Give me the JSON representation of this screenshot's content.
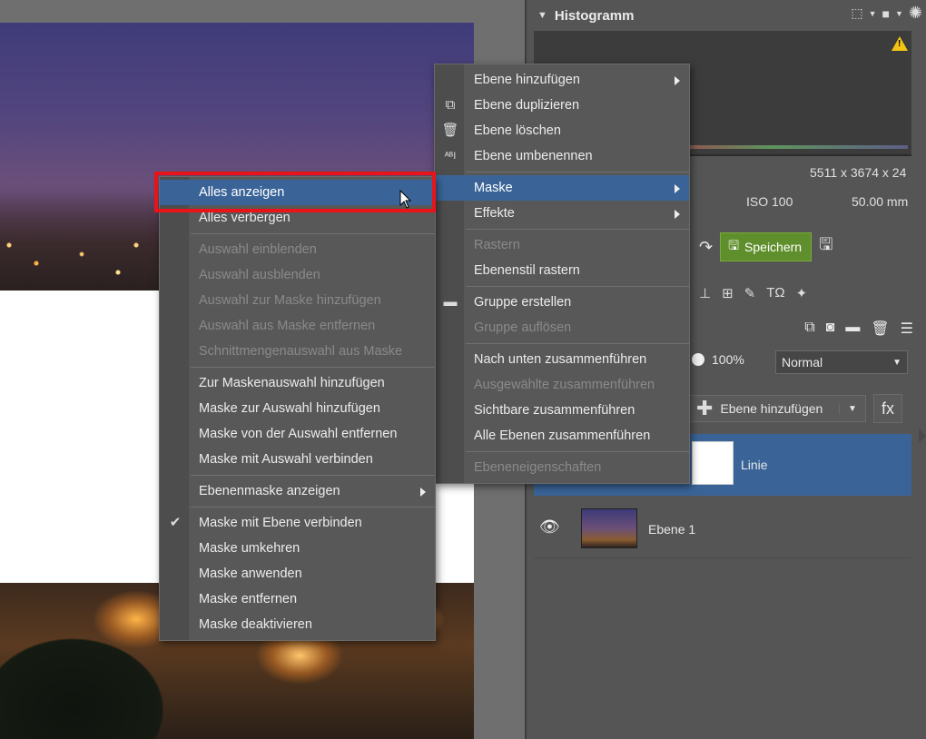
{
  "histogram": {
    "title": "Histogramm",
    "dimensions": "5511 x 3674 x 24",
    "iso": "ISO 100",
    "focal": "50.00 mm"
  },
  "toolbar": {
    "save_label": "Speichern"
  },
  "layers": {
    "opacity": "100%",
    "blend_mode": "Normal",
    "add_layer_label": "Ebene hinzufügen",
    "fx_label": "fx",
    "items": [
      {
        "name": "Linie",
        "selected": true
      },
      {
        "name": "Ebene 1",
        "selected": false
      }
    ]
  },
  "main_menu": {
    "items": [
      {
        "label": "Ebene hinzufügen",
        "submenu": true
      },
      {
        "label": "Ebene duplizieren",
        "icon": "duplicate-icon"
      },
      {
        "label": "Ebene löschen",
        "icon": "trash-icon"
      },
      {
        "label": "Ebene umbenennen",
        "icon": "rename-icon"
      },
      {
        "label": "Maske",
        "submenu": true,
        "highlighted": true
      },
      {
        "label": "Effekte",
        "submenu": true
      },
      {
        "label": "Rastern",
        "disabled": true
      },
      {
        "label": "Ebenenstil rastern"
      },
      {
        "label": "Gruppe erstellen",
        "icon": "folder-icon"
      },
      {
        "label": "Gruppe auflösen",
        "disabled": true
      },
      {
        "label": "Nach unten zusammenführen"
      },
      {
        "label": "Ausgewählte zusammenführen",
        "disabled": true
      },
      {
        "label": "Sichtbare zusammenführen"
      },
      {
        "label": "Alle Ebenen zusammenführen"
      },
      {
        "label": "Ebeneneigenschaften",
        "disabled": true
      }
    ]
  },
  "mask_menu": {
    "items": [
      {
        "label": "Alles anzeigen",
        "highlighted": true
      },
      {
        "label": "Alles verbergen"
      },
      {
        "label": "Auswahl einblenden",
        "disabled": true
      },
      {
        "label": "Auswahl ausblenden",
        "disabled": true
      },
      {
        "label": "Auswahl zur Maske hinzufügen",
        "disabled": true
      },
      {
        "label": "Auswahl aus Maske entfernen",
        "disabled": true
      },
      {
        "label": "Schnittmengenauswahl aus Maske",
        "disabled": true
      },
      {
        "label": "Zur Maskenauswahl hinzufügen"
      },
      {
        "label": "Maske zur Auswahl hinzufügen"
      },
      {
        "label": "Maske von der Auswahl entfernen"
      },
      {
        "label": "Maske mit Auswahl verbinden"
      },
      {
        "label": "Ebenenmaske anzeigen",
        "submenu": true
      },
      {
        "label": "Maske mit Ebene verbinden",
        "checked": true
      },
      {
        "label": "Maske umkehren"
      },
      {
        "label": "Maske anwenden"
      },
      {
        "label": "Maske entfernen"
      },
      {
        "label": "Maske deaktivieren"
      }
    ]
  },
  "colors": {
    "highlight": "#3a6498",
    "save_green": "#5f8f2c",
    "annotation_red": "#e8141a"
  }
}
